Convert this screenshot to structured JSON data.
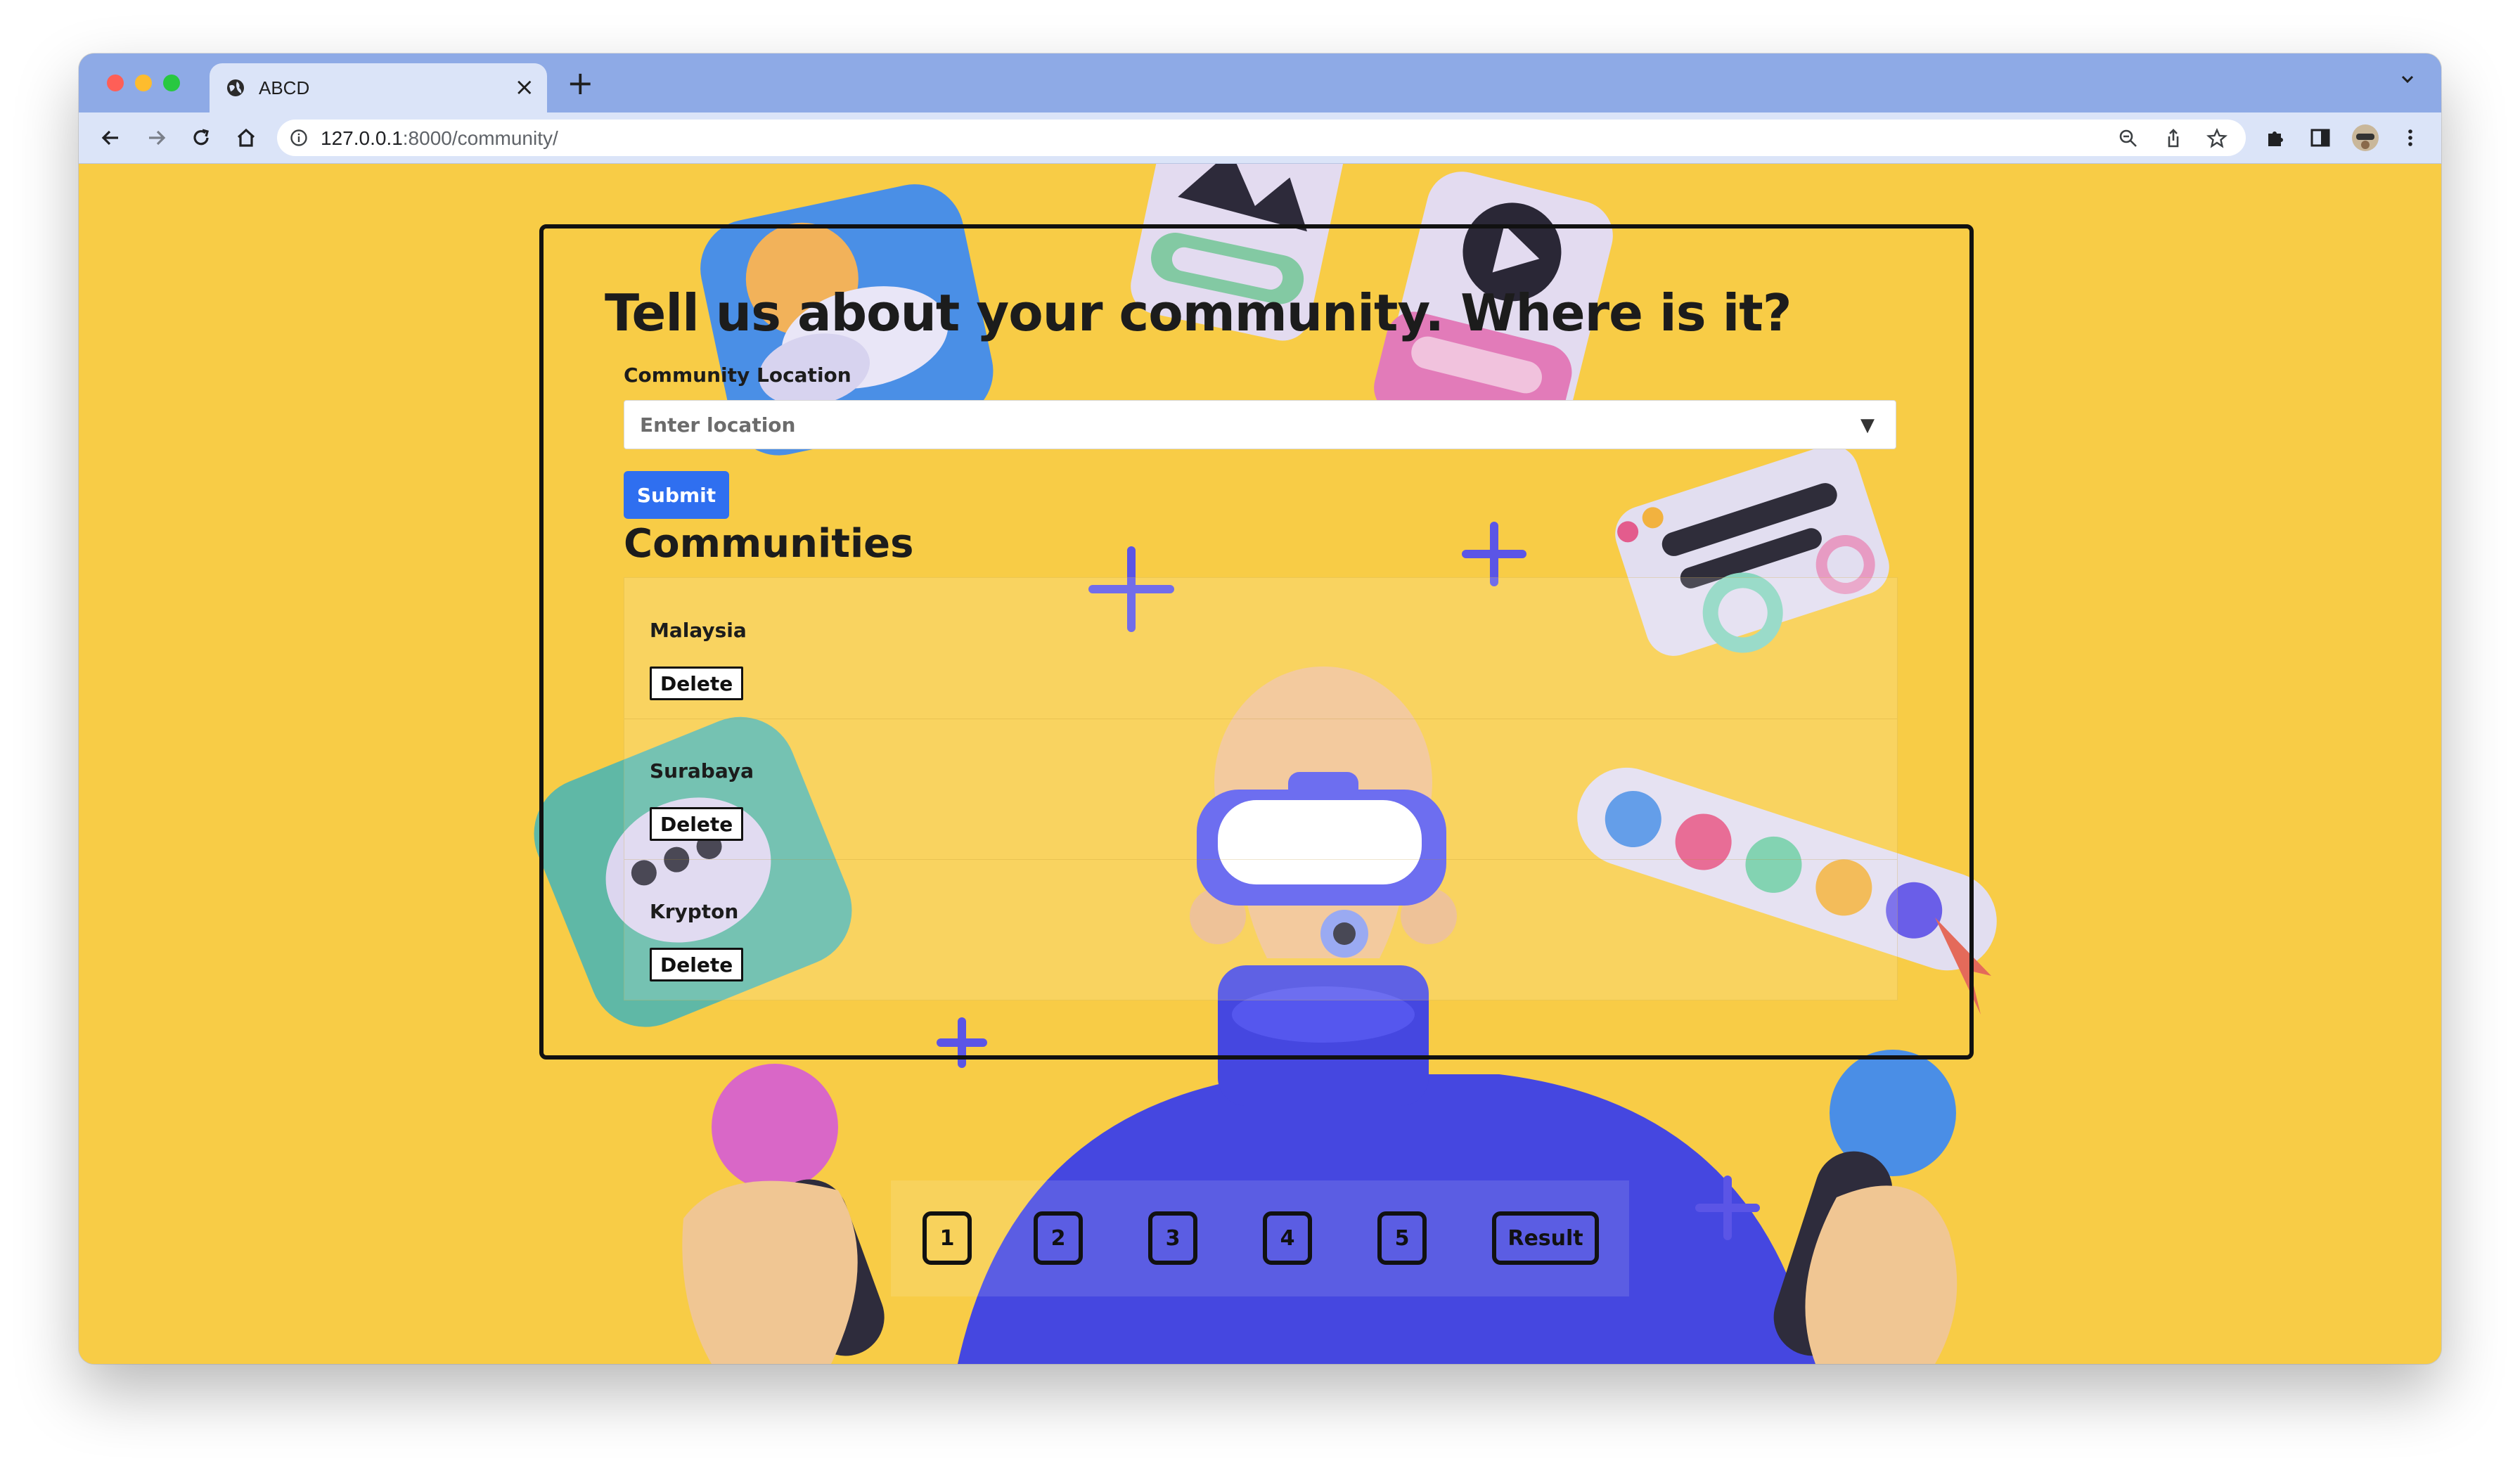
{
  "browser": {
    "tab_title": "ABCD",
    "url_host": "127.0.0.1",
    "url_path": ":8000/community/"
  },
  "page": {
    "heading": "Tell us about your community. Where is it?",
    "location_label": "Community Location",
    "location_placeholder": "Enter location",
    "submit_label": "Submit",
    "communities_title": "Communities",
    "communities": [
      {
        "name": "Malaysia",
        "delete_label": "Delete"
      },
      {
        "name": "Surabaya",
        "delete_label": "Delete"
      },
      {
        "name": "Krypton",
        "delete_label": "Delete"
      }
    ],
    "pagination": [
      "1",
      "2",
      "3",
      "4",
      "5",
      "Result"
    ]
  },
  "colors": {
    "background": "#f8cc46",
    "accent": "#2f6ff0",
    "browser_tab_bar": "#8eaae6",
    "browser_toolbar": "#dbe4f8"
  }
}
